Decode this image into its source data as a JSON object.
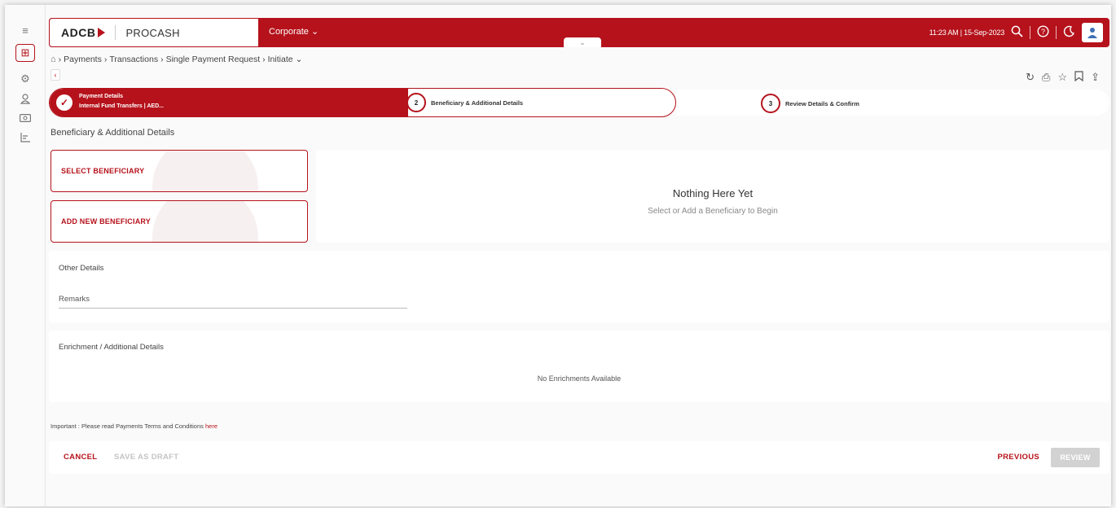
{
  "rail": {
    "icons": [
      "menu-icon",
      "dashboard-icon",
      "settings-icon",
      "user-icon",
      "payments-icon",
      "reports-icon"
    ]
  },
  "header": {
    "logo": "ADCB",
    "product": "PROCASH",
    "context": "Corporate",
    "datetime": "11:23 AM | 15-Sep-2023"
  },
  "breadcrumb": {
    "items": [
      "Payments",
      "Transactions",
      "Single Payment Request",
      "Initiate"
    ]
  },
  "stepper": {
    "step1_title": "Payment Details",
    "step1_subtitle": "Internal Fund Transfers | AED...",
    "step2_num": "2",
    "step2_label": "Beneficiary & Additional Details",
    "step3_num": "3",
    "step3_label": "Review Details & Confirm"
  },
  "section_title": "Beneficiary & Additional Details",
  "beneficiary": {
    "select_label": "SELECT BENEFICIARY",
    "add_label": "ADD NEW BENEFICIARY",
    "empty_title": "Nothing Here Yet",
    "empty_subtitle": "Select or Add a Beneficiary to Begin"
  },
  "other_details": {
    "title": "Other Details",
    "remarks_label": "Remarks"
  },
  "enrichment": {
    "title": "Enrichment / Additional Details",
    "empty": "No Enrichments Available"
  },
  "important": {
    "prefix": "Important :",
    "text": "Please read Payments Terms and Conditions",
    "link": "here"
  },
  "footer": {
    "cancel": "CANCEL",
    "save_draft": "SAVE AS DRAFT",
    "previous": "PREVIOUS",
    "review": "REVIEW"
  },
  "colors": {
    "brand": "#b5121b",
    "disabled": "#d2d2d2"
  }
}
